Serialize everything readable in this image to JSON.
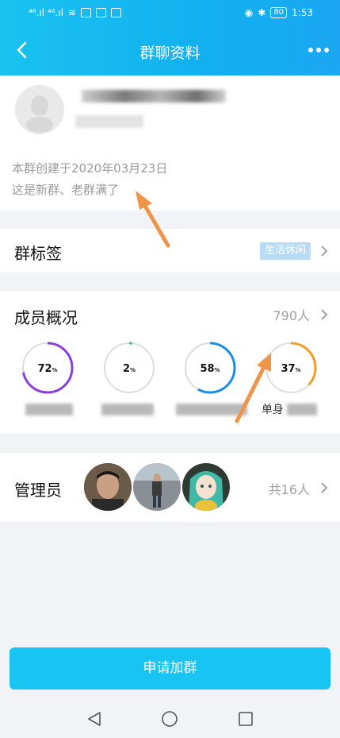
{
  "status_bar": {
    "signal_left": "⁴⁶.ıl ⁴⁶.ıl",
    "battery": "80",
    "time": "1:53"
  },
  "header": {
    "title": "群聊资料",
    "more": "•••"
  },
  "group": {
    "created": "本群创建于2020年03月23日",
    "description": "这是新群、老群满了"
  },
  "tags": {
    "label": "群标签",
    "tag": "生活休闲"
  },
  "members": {
    "label": "成员概况",
    "count": "790人",
    "stats": [
      {
        "value": "72",
        "unit": "%",
        "fraction": 0.72,
        "color": "#8b3fd9",
        "label_prefix": ""
      },
      {
        "value": "2",
        "unit": "%",
        "fraction": 0.02,
        "color": "#37c8a0",
        "label_prefix": ""
      },
      {
        "value": "58",
        "unit": "%",
        "fraction": 0.58,
        "color": "#1b8de6",
        "label_prefix": ""
      },
      {
        "value": "37",
        "unit": "%",
        "fraction": 0.37,
        "color": "#f29a2a",
        "label_prefix": "单身"
      }
    ]
  },
  "admins": {
    "label": "管理员",
    "count": "共16人"
  },
  "apply_button": "申请加群"
}
